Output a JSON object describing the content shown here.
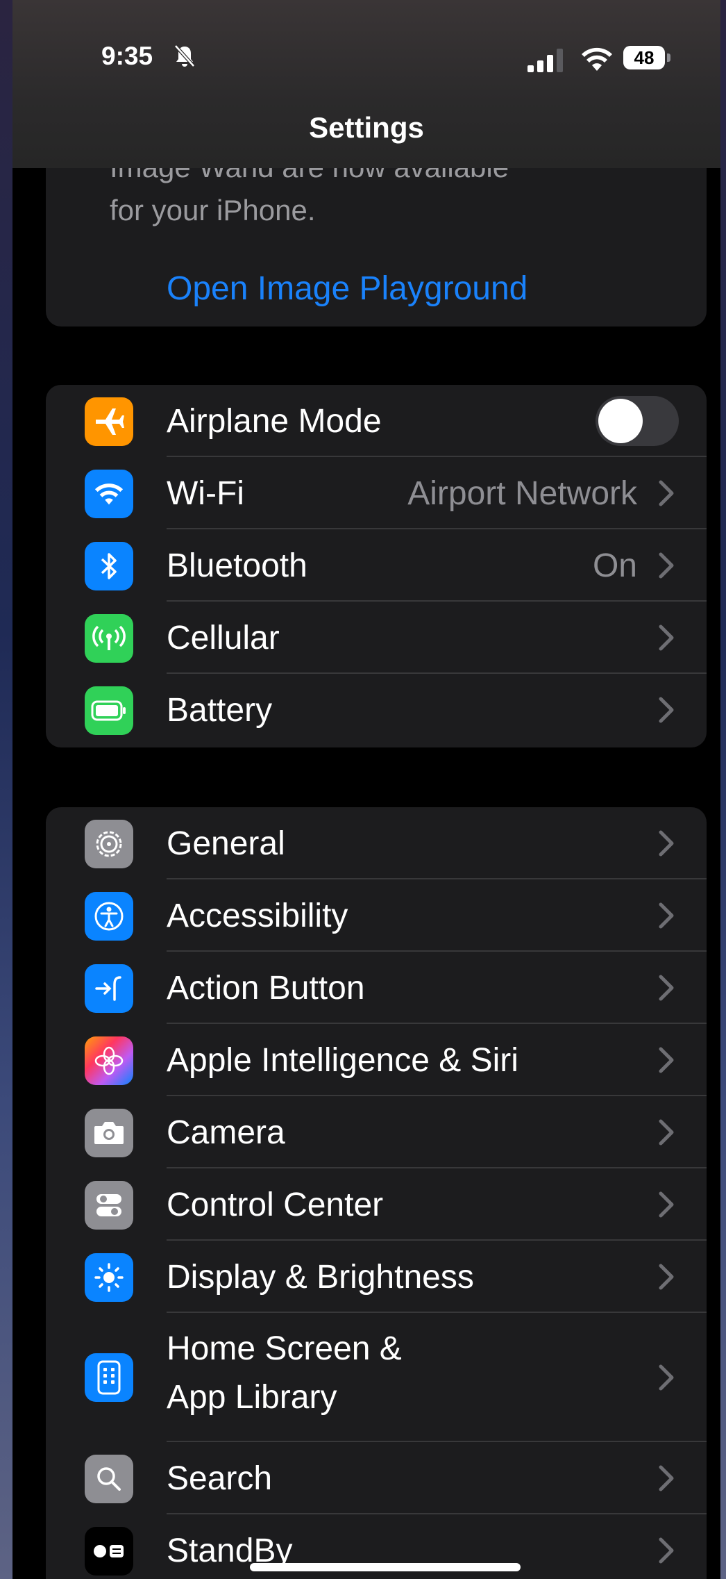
{
  "status_bar": {
    "time": "9:35",
    "battery_level": "48"
  },
  "nav": {
    "title": "Settings"
  },
  "banner": {
    "text_line1": "Image Wand are now available",
    "text_line2": "for your iPhone.",
    "link": "Open Image Playground"
  },
  "connectivity": {
    "airplane": {
      "label": "Airplane Mode",
      "on": false,
      "icon": "airplane-icon",
      "color": "#ff9500"
    },
    "wifi": {
      "label": "Wi-Fi",
      "value": "Airport Network",
      "icon": "wifi-icon",
      "color": "#0a84ff"
    },
    "bluetooth": {
      "label": "Bluetooth",
      "value": "On",
      "icon": "bluetooth-icon",
      "color": "#0a84ff"
    },
    "cellular": {
      "label": "Cellular",
      "icon": "antenna-icon",
      "color": "#30d158"
    },
    "battery": {
      "label": "Battery",
      "icon": "battery-icon",
      "color": "#30d158"
    }
  },
  "system": [
    {
      "label": "General",
      "icon": "gear-icon",
      "color": "#8e8e93"
    },
    {
      "label": "Accessibility",
      "icon": "accessibility-icon",
      "color": "#0a84ff"
    },
    {
      "label": "Action Button",
      "icon": "action-button-icon",
      "color": "#0a84ff"
    },
    {
      "label": "Apple Intelligence & Siri",
      "icon": "apple-intelligence-icon",
      "color": "#bf5af2"
    },
    {
      "label": "Camera",
      "icon": "camera-icon",
      "color": "#8e8e93"
    },
    {
      "label": "Control Center",
      "icon": "control-center-icon",
      "color": "#8e8e93"
    },
    {
      "label": "Display & Brightness",
      "icon": "sun-icon",
      "color": "#0a84ff"
    },
    {
      "label_line1": "Home Screen &",
      "label_line2": "App Library",
      "icon": "home-screen-icon",
      "color": "#0a84ff"
    },
    {
      "label": "Search",
      "icon": "magnifier-icon",
      "color": "#8e8e93"
    },
    {
      "label": "StandBy",
      "icon": "standby-icon",
      "color": "#000000"
    }
  ]
}
